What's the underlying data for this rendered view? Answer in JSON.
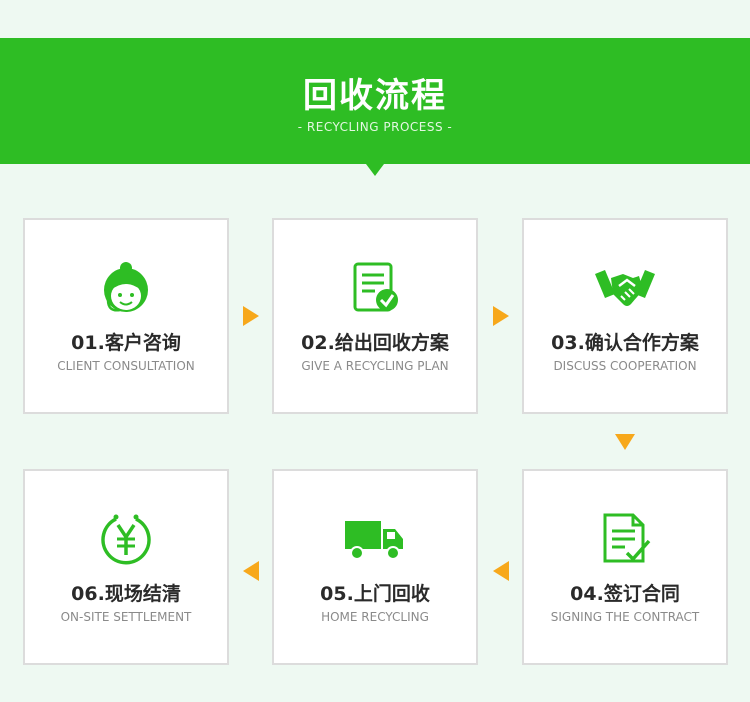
{
  "header": {
    "title": "回收流程",
    "subtitle": "- RECYCLING PROCESS -"
  },
  "steps": [
    {
      "title": "01.客户咨询",
      "subtitle": "CLIENT CONSULTATION",
      "icon": "customer-service-icon"
    },
    {
      "title": "02.给出回收方案",
      "subtitle": "GIVE A RECYCLING PLAN",
      "icon": "plan-document-icon"
    },
    {
      "title": "03.确认合作方案",
      "subtitle": "DISCUSS COOPERATION",
      "icon": "handshake-icon"
    },
    {
      "title": "04.签订合同",
      "subtitle": "SIGNING THE CONTRACT",
      "icon": "contract-icon"
    },
    {
      "title": "05.上门回收",
      "subtitle": "HOME RECYCLING",
      "icon": "truck-icon"
    },
    {
      "title": "06.现场结清",
      "subtitle": "ON-SITE SETTLEMENT",
      "icon": "yuan-payment-icon"
    }
  ],
  "colors": {
    "brand_green": "#2ebd24",
    "arrow_orange": "#f7a81b",
    "background": "#eef9f2"
  }
}
